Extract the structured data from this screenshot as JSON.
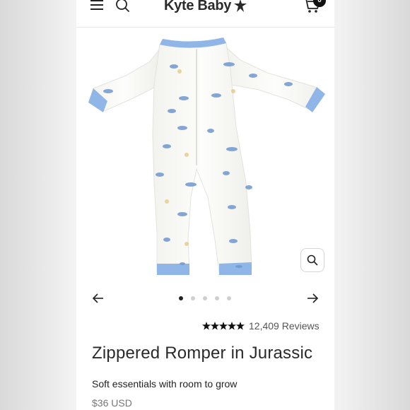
{
  "header": {
    "logo_text": "Kyte Baby",
    "cart_count": "0"
  },
  "gallery": {
    "product_image": "zippered-romper-dinosaur-print-photo",
    "slide_count": 5,
    "active_slide": 1
  },
  "product": {
    "rating_value": 5,
    "review_count": "12,409 Reviews",
    "title": "Zippered Romper in Jurassic",
    "subtitle": "Soft essentials with room to grow",
    "price": "$36 USD"
  },
  "colors": {
    "trim_blue": "#8fb6e6",
    "fabric": "#fbfbf8",
    "text": "#222222",
    "muted": "#777777"
  },
  "icons": [
    "menu-icon",
    "search-icon",
    "logo-star-icon",
    "cart-icon",
    "zoom-icon",
    "arrow-left-icon",
    "arrow-right-icon",
    "star-icon"
  ]
}
